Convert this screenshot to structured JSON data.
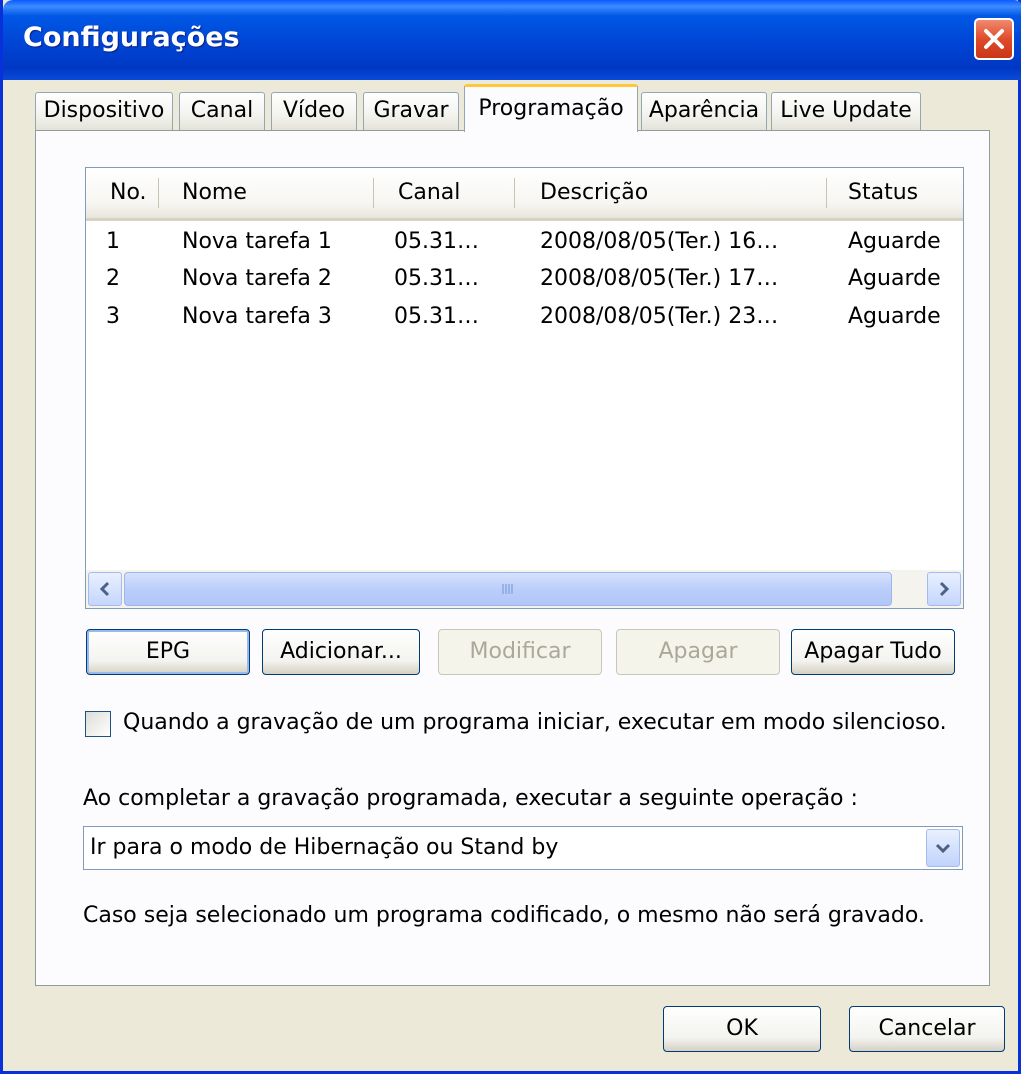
{
  "window": {
    "title": "Configurações"
  },
  "tabs": [
    {
      "label": "Dispositivo"
    },
    {
      "label": "Canal"
    },
    {
      "label": "Vídeo"
    },
    {
      "label": "Gravar"
    },
    {
      "label": "Programação",
      "active": true
    },
    {
      "label": "Aparência"
    },
    {
      "label": "Live Update"
    }
  ],
  "schedule": {
    "columns": [
      "No.",
      "Nome",
      "Canal",
      "Descrição",
      "Status"
    ],
    "rows": [
      [
        "1",
        "Nova tarefa 1",
        "05.31…",
        "2008/08/05(Ter.) 16…",
        "Aguarde"
      ],
      [
        "2",
        "Nova tarefa 2",
        "05.31…",
        "2008/08/05(Ter.) 17…",
        "Aguarde"
      ],
      [
        "3",
        "Nova tarefa 3",
        "05.31…",
        "2008/08/05(Ter.) 23…",
        "Aguarde"
      ]
    ]
  },
  "buttons": {
    "epg": "EPG",
    "add": "Adicionar...",
    "modify": "Modificar",
    "delete": "Apagar",
    "delete_all": "Apagar Tudo",
    "ok": "OK",
    "cancel": "Cancelar"
  },
  "silent_mode": {
    "label": "Quando a gravação de um programa iniciar, executar em modo silencioso.",
    "checked": false
  },
  "after_recording": {
    "label": "Ao completar a gravação programada, executar a seguinte operação :",
    "selected": "Ir para o modo de Hibernação ou Stand by"
  },
  "note": "Caso seja selecionado um programa codificado, o mesmo não será gravado.",
  "colors": {
    "titlebar": "#0054E3",
    "close": "#E04B2A",
    "tab_highlight": "#FFC83C",
    "disabled_text": "#ACA899"
  }
}
